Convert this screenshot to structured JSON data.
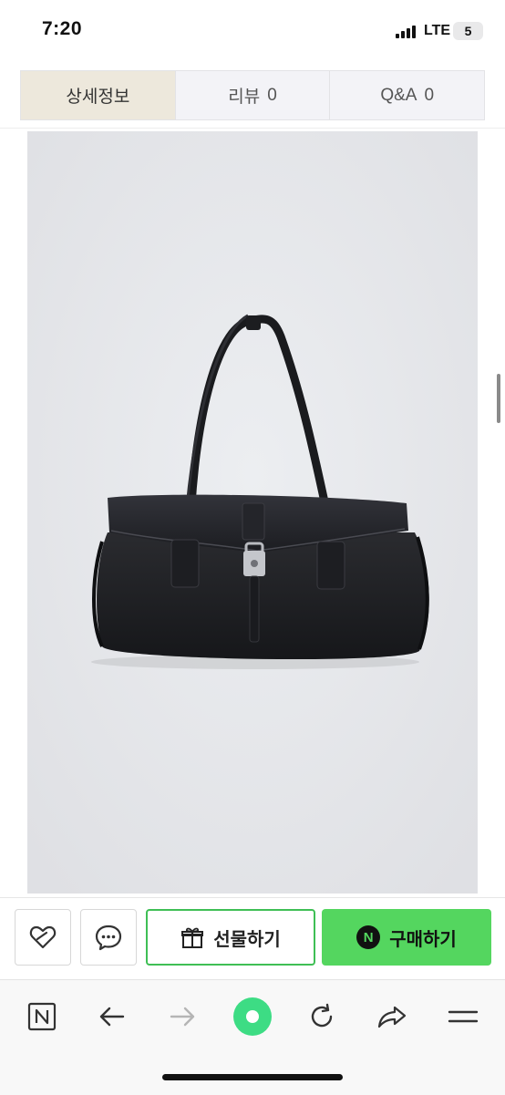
{
  "status_bar": {
    "time": "7:20",
    "network": "LTE",
    "battery": "5"
  },
  "tabs": [
    {
      "label": "상세정보",
      "count": "",
      "active": true
    },
    {
      "label": "리뷰",
      "count": "0",
      "active": false
    },
    {
      "label": "Q&A",
      "count": "0",
      "active": false
    }
  ],
  "product_image": {
    "subject": "black leather shoulder bag with silver lock",
    "background": "#e6e7ea"
  },
  "buy_bar": {
    "wish_icon": "heart-icon",
    "chat_icon": "chat-bubble-icon",
    "gift_label": "선물하기",
    "gift_icon": "gift-icon",
    "buy_label": "구매하기",
    "buy_badge": "N",
    "accent": "#54d65f"
  },
  "browser_toolbar": {
    "icons": [
      "naver-n-icon",
      "back-arrow-icon",
      "forward-arrow-icon",
      "green-dot-icon",
      "reload-icon",
      "share-icon",
      "menu-icon"
    ],
    "home_dot_color": "#3ddc84"
  }
}
